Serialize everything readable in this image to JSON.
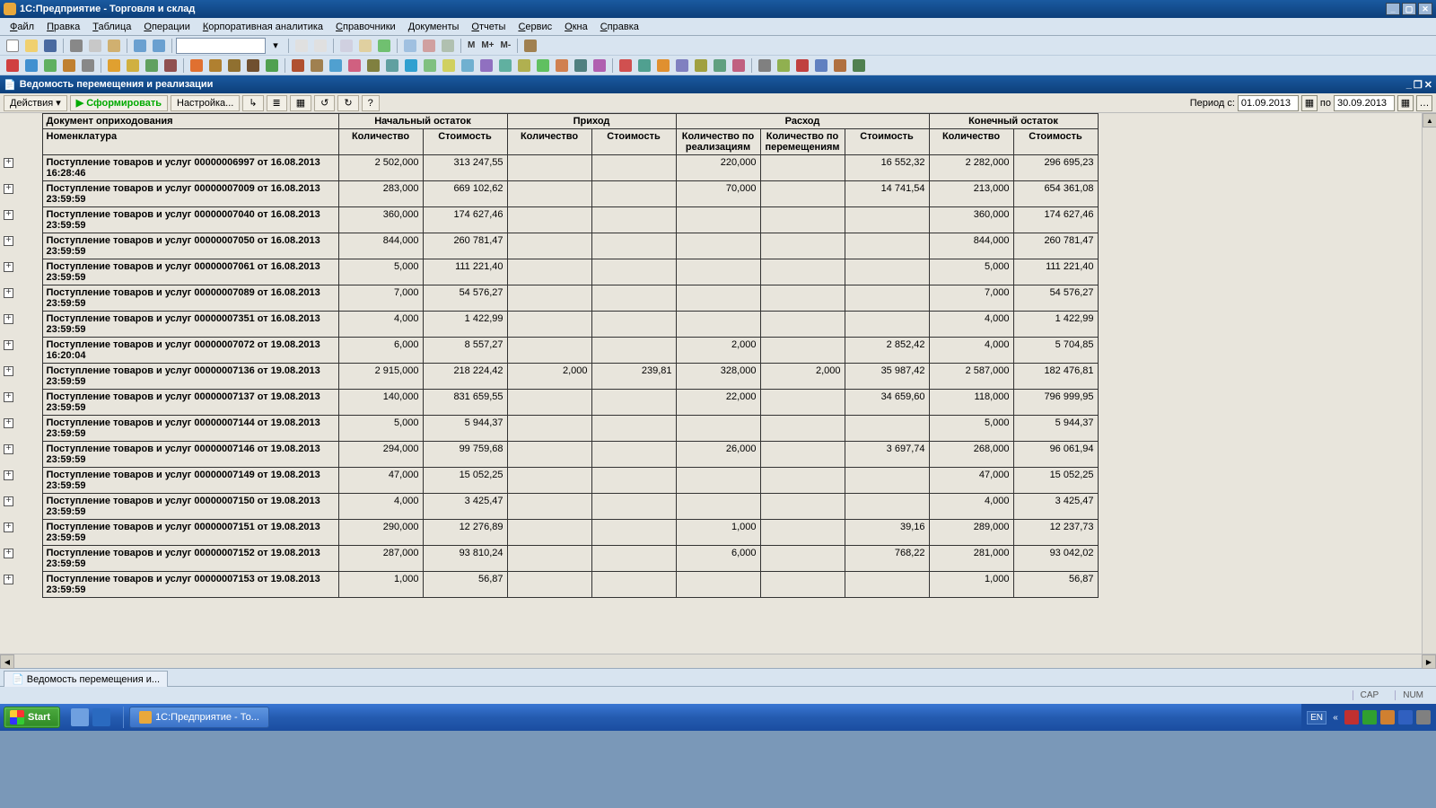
{
  "app_title": "1С:Предприятие - Торговля и склад",
  "menu": [
    "Файл",
    "Правка",
    "Таблица",
    "Операции",
    "Корпоративная аналитика",
    "Справочники",
    "Документы",
    "Отчеты",
    "Сервис",
    "Окна",
    "Справка"
  ],
  "report_title": "Ведомость перемещения и реализации",
  "actions": {
    "actions_label": "Действия",
    "form_label": "Сформировать",
    "setup_label": "Настройка...",
    "period_label": "Период с:",
    "from": "01.09.2013",
    "to_label": "по",
    "to": "30.09.2013"
  },
  "headers": {
    "doc": "Документ оприходования",
    "nomen": "Номенклатура",
    "grp_begin": "Начальный остаток",
    "grp_in": "Приход",
    "grp_out": "Расход",
    "grp_end": "Конечный остаток",
    "qty": "Количество",
    "cost": "Стоимость",
    "qty_real": "Количество по реализациям",
    "qty_move": "Количество по перемещениям"
  },
  "rows": [
    {
      "doc": "Поступление товаров и услуг 00000006997 от 16.08.2013 16:28:46",
      "bq": "2 502,000",
      "bc": "313 247,55",
      "iq": "",
      "ic": "",
      "oqr": "220,000",
      "oqm": "",
      "oc": "16 552,32",
      "eq": "2 282,000",
      "ec": "296 695,23"
    },
    {
      "doc": "Поступление товаров и услуг 00000007009 от 16.08.2013 23:59:59",
      "bq": "283,000",
      "bc": "669 102,62",
      "iq": "",
      "ic": "",
      "oqr": "70,000",
      "oqm": "",
      "oc": "14 741,54",
      "eq": "213,000",
      "ec": "654 361,08"
    },
    {
      "doc": "Поступление товаров и услуг 00000007040 от 16.08.2013 23:59:59",
      "bq": "360,000",
      "bc": "174 627,46",
      "iq": "",
      "ic": "",
      "oqr": "",
      "oqm": "",
      "oc": "",
      "eq": "360,000",
      "ec": "174 627,46"
    },
    {
      "doc": "Поступление товаров и услуг 00000007050 от 16.08.2013 23:59:59",
      "bq": "844,000",
      "bc": "260 781,47",
      "iq": "",
      "ic": "",
      "oqr": "",
      "oqm": "",
      "oc": "",
      "eq": "844,000",
      "ec": "260 781,47"
    },
    {
      "doc": "Поступление товаров и услуг 00000007061 от 16.08.2013 23:59:59",
      "bq": "5,000",
      "bc": "111 221,40",
      "iq": "",
      "ic": "",
      "oqr": "",
      "oqm": "",
      "oc": "",
      "eq": "5,000",
      "ec": "111 221,40"
    },
    {
      "doc": "Поступление товаров и услуг 00000007089 от 16.08.2013 23:59:59",
      "bq": "7,000",
      "bc": "54 576,27",
      "iq": "",
      "ic": "",
      "oqr": "",
      "oqm": "",
      "oc": "",
      "eq": "7,000",
      "ec": "54 576,27"
    },
    {
      "doc": "Поступление товаров и услуг 00000007351 от 16.08.2013 23:59:59",
      "bq": "4,000",
      "bc": "1 422,99",
      "iq": "",
      "ic": "",
      "oqr": "",
      "oqm": "",
      "oc": "",
      "eq": "4,000",
      "ec": "1 422,99"
    },
    {
      "doc": "Поступление товаров и услуг 00000007072 от 19.08.2013 16:20:04",
      "bq": "6,000",
      "bc": "8 557,27",
      "iq": "",
      "ic": "",
      "oqr": "2,000",
      "oqm": "",
      "oc": "2 852,42",
      "eq": "4,000",
      "ec": "5 704,85"
    },
    {
      "doc": "Поступление товаров и услуг 00000007136 от 19.08.2013 23:59:59",
      "bq": "2 915,000",
      "bc": "218 224,42",
      "iq": "2,000",
      "ic": "239,81",
      "oqr": "328,000",
      "oqm": "2,000",
      "oc": "35 987,42",
      "eq": "2 587,000",
      "ec": "182 476,81"
    },
    {
      "doc": "Поступление товаров и услуг 00000007137 от 19.08.2013 23:59:59",
      "bq": "140,000",
      "bc": "831 659,55",
      "iq": "",
      "ic": "",
      "oqr": "22,000",
      "oqm": "",
      "oc": "34 659,60",
      "eq": "118,000",
      "ec": "796 999,95"
    },
    {
      "doc": "Поступление товаров и услуг 00000007144 от 19.08.2013 23:59:59",
      "bq": "5,000",
      "bc": "5 944,37",
      "iq": "",
      "ic": "",
      "oqr": "",
      "oqm": "",
      "oc": "",
      "eq": "5,000",
      "ec": "5 944,37"
    },
    {
      "doc": "Поступление товаров и услуг 00000007146 от 19.08.2013 23:59:59",
      "bq": "294,000",
      "bc": "99 759,68",
      "iq": "",
      "ic": "",
      "oqr": "26,000",
      "oqm": "",
      "oc": "3 697,74",
      "eq": "268,000",
      "ec": "96 061,94"
    },
    {
      "doc": "Поступление товаров и услуг 00000007149 от 19.08.2013 23:59:59",
      "bq": "47,000",
      "bc": "15 052,25",
      "iq": "",
      "ic": "",
      "oqr": "",
      "oqm": "",
      "oc": "",
      "eq": "47,000",
      "ec": "15 052,25"
    },
    {
      "doc": "Поступление товаров и услуг 00000007150 от 19.08.2013 23:59:59",
      "bq": "4,000",
      "bc": "3 425,47",
      "iq": "",
      "ic": "",
      "oqr": "",
      "oqm": "",
      "oc": "",
      "eq": "4,000",
      "ec": "3 425,47"
    },
    {
      "doc": "Поступление товаров и услуг 00000007151 от 19.08.2013 23:59:59",
      "bq": "290,000",
      "bc": "12 276,89",
      "iq": "",
      "ic": "",
      "oqr": "1,000",
      "oqm": "",
      "oc": "39,16",
      "eq": "289,000",
      "ec": "12 237,73"
    },
    {
      "doc": "Поступление товаров и услуг 00000007152 от 19.08.2013 23:59:59",
      "bq": "287,000",
      "bc": "93 810,24",
      "iq": "",
      "ic": "",
      "oqr": "6,000",
      "oqm": "",
      "oc": "768,22",
      "eq": "281,000",
      "ec": "93 042,02"
    },
    {
      "doc": "Поступление товаров и услуг 00000007153 от 19.08.2013 23:59:59",
      "bq": "1,000",
      "bc": "56,87",
      "iq": "",
      "ic": "",
      "oqr": "",
      "oqm": "",
      "oc": "",
      "eq": "1,000",
      "ec": "56,87"
    }
  ],
  "tab_label": "Ведомость перемещения и...",
  "status": {
    "cap": "CAP",
    "num": "NUM"
  },
  "taskbar": {
    "start": "Start",
    "task": "1С:Предприятие - То...",
    "lang": "EN"
  },
  "m_labels": {
    "m": "M",
    "mplus": "M+",
    "mminus": "M-"
  }
}
